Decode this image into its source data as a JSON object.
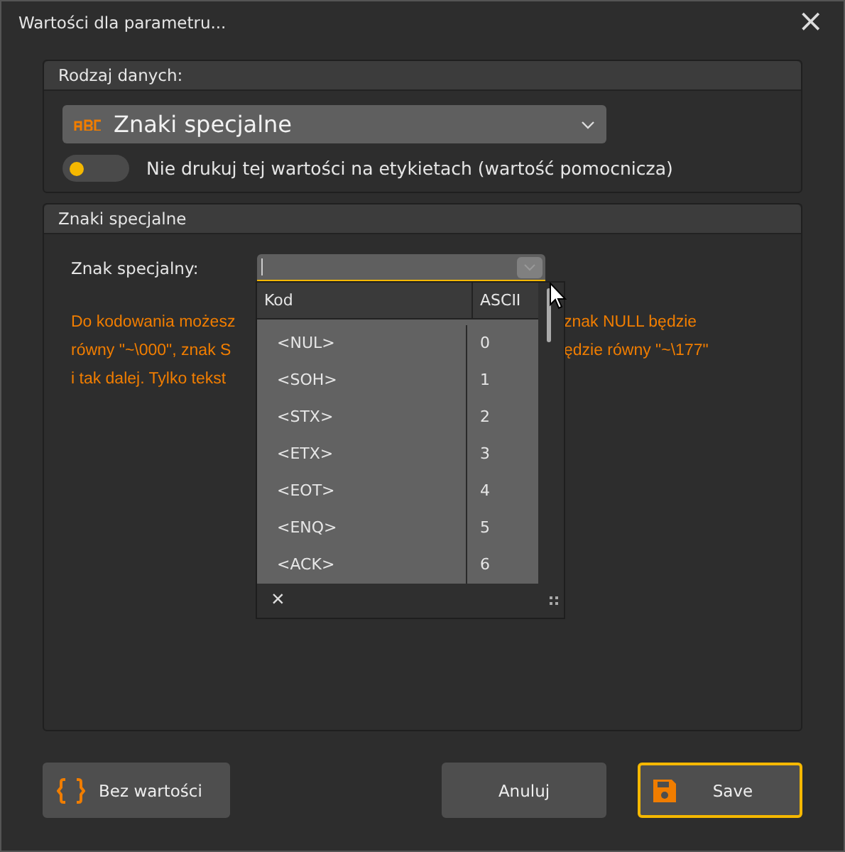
{
  "window": {
    "title": "Wartości dla parametru...",
    "close": "×"
  },
  "data_type_panel": {
    "title": "Rodzaj danych:",
    "dropdown": {
      "value": "Znaki specjalne"
    },
    "toggle": {
      "on": false,
      "label": "Nie drukuj tej wartości na etykietach (wartość pomocnicza)"
    }
  },
  "special_panel": {
    "title": "Znaki specjalne",
    "field_label": "Znak specjalny:",
    "help_left": [
      "Do kodowania możesz",
      "równy \"~\\000\", znak S",
      "i tak dalej. Tylko tekst"
    ],
    "help_right": [
      "znak NULL będzie",
      "ędzie równy \"~\\177\""
    ],
    "popup": {
      "columns": [
        "Kod",
        "ASCII"
      ],
      "rows": [
        {
          "code": "<NUL>",
          "ascii": "0"
        },
        {
          "code": "<SOH>",
          "ascii": "1"
        },
        {
          "code": "<STX>",
          "ascii": "2"
        },
        {
          "code": "<ETX>",
          "ascii": "3"
        },
        {
          "code": "<EOT>",
          "ascii": "4"
        },
        {
          "code": "<ENQ>",
          "ascii": "5"
        },
        {
          "code": "<ACK>",
          "ascii": "6"
        }
      ],
      "clear": "×"
    }
  },
  "buttons": [
    {
      "kind": "clear",
      "label": "Bez wartości",
      "primary": false
    },
    {
      "kind": "cancel",
      "label": "Anuluj",
      "primary": false
    },
    {
      "kind": "save",
      "label": "Save",
      "primary": true
    }
  ]
}
